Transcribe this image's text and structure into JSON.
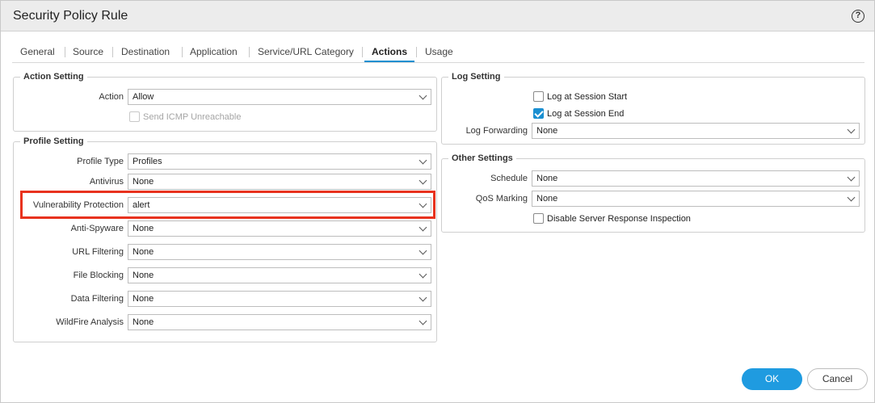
{
  "dialog": {
    "title": "Security Policy Rule",
    "help_symbol": "?"
  },
  "tabs": [
    {
      "label": "General"
    },
    {
      "label": "Source"
    },
    {
      "label": "Destination"
    },
    {
      "label": "Application"
    },
    {
      "label": "Service/URL Category"
    },
    {
      "label": "Actions",
      "active": true
    },
    {
      "label": "Usage"
    }
  ],
  "action_setting": {
    "legend": "Action Setting",
    "action_label": "Action",
    "action_value": "Allow",
    "icmp_label": "Send ICMP Unreachable",
    "icmp_checked": false
  },
  "profile_setting": {
    "legend": "Profile Setting",
    "fields": [
      {
        "label": "Profile Type",
        "value": "Profiles"
      },
      {
        "label": "Antivirus",
        "value": "None"
      },
      {
        "label": "Vulnerability Protection",
        "value": "alert"
      },
      {
        "label": "Anti-Spyware",
        "value": "None"
      },
      {
        "label": "URL Filtering",
        "value": "None"
      },
      {
        "label": "File Blocking",
        "value": "None"
      },
      {
        "label": "Data Filtering",
        "value": "None"
      },
      {
        "label": "WildFire Analysis",
        "value": "None"
      }
    ]
  },
  "log_setting": {
    "legend": "Log Setting",
    "log_start_label": "Log at Session Start",
    "log_start_checked": false,
    "log_end_label": "Log at Session End",
    "log_end_checked": true,
    "forwarding_label": "Log Forwarding",
    "forwarding_value": "None"
  },
  "other_settings": {
    "legend": "Other Settings",
    "schedule_label": "Schedule",
    "schedule_value": "None",
    "qos_label": "QoS Marking",
    "qos_value": "None",
    "disable_sri_label": "Disable Server Response Inspection",
    "disable_sri_checked": false
  },
  "buttons": {
    "ok": "OK",
    "cancel": "Cancel"
  },
  "colors": {
    "accent": "#1f9be0",
    "highlight": "#e8321e"
  }
}
